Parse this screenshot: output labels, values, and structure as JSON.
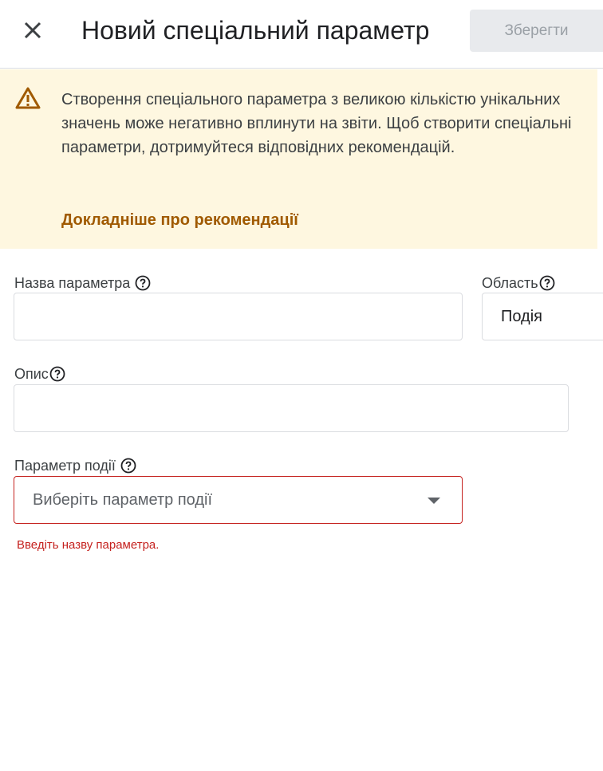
{
  "header": {
    "title": "Новий спеціальний параметр",
    "save_label": "Зберегти",
    "close_icon": "close-icon"
  },
  "warning": {
    "icon": "warning-icon",
    "text": "Створення спеціального параметра з великою кількістю унікальних значень може негативно вплинути на звіти. Щоб створити спеціальні параметри, дотримуйтеся відповідних рекомендацій.",
    "link": "Докладніше про рекомендації",
    "background_color": "#fef7e0",
    "link_color": "#a05a00"
  },
  "form": {
    "name": {
      "label": "Назва параметра",
      "value": ""
    },
    "scope": {
      "label": "Область",
      "value": "Подія"
    },
    "description": {
      "label": "Опис",
      "value": ""
    },
    "event_param": {
      "label": "Параметр події",
      "placeholder": "Виберіть параметр події",
      "error": "Введіть назву параметра."
    }
  },
  "colors": {
    "error": "#c5221f",
    "border": "#dadce0"
  }
}
